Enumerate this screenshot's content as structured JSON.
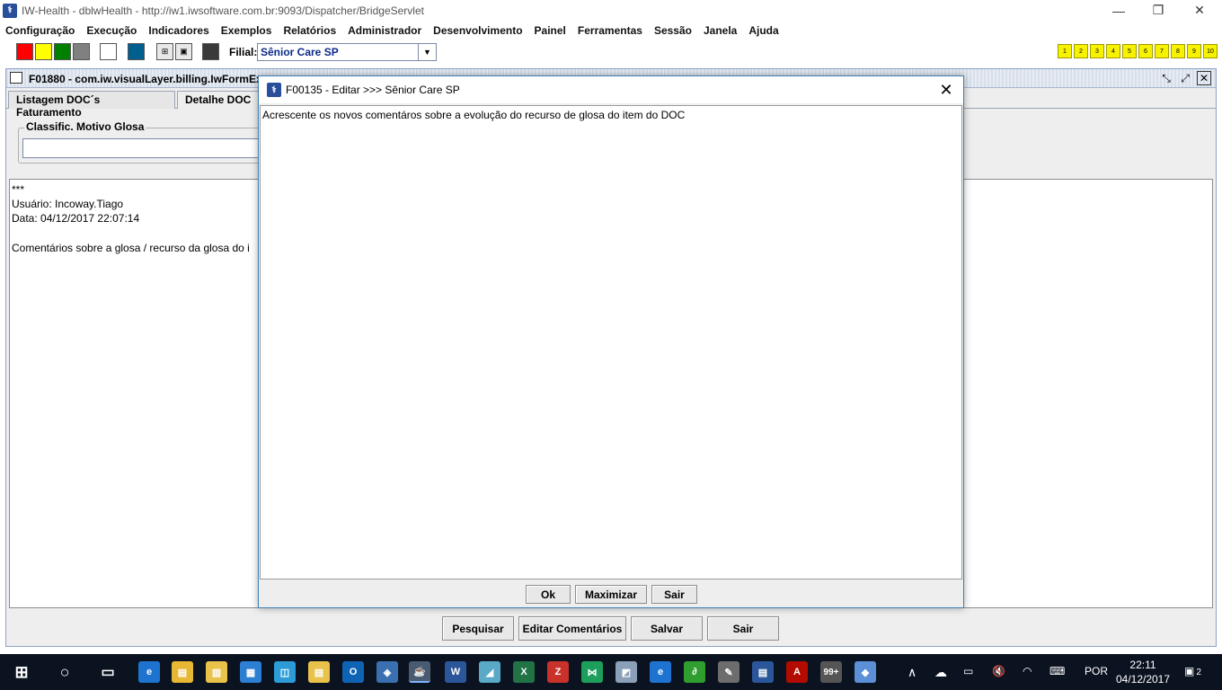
{
  "window": {
    "title": "IW-Health - dblwHealth - http://iw1.iwsoftware.com.br:9093/Dispatcher/BridgeServlet",
    "minimize": "—",
    "restore": "❐",
    "close": "✕"
  },
  "menu": [
    "Configuração",
    "Execução",
    "Indicadores",
    "Exemplos",
    "Relatórios",
    "Administrador",
    "Desenvolvimento",
    "Painel",
    "Ferramentas",
    "Sessão",
    "Janela",
    "Ajuda"
  ],
  "toolbar": {
    "swatches": [
      "#ff0000",
      "#ffff00",
      "#008000",
      "#808080",
      "#ffffff",
      "#005f8f",
      "#3a3a3a"
    ],
    "filial_label": "Filial:",
    "filial_value": "Sênior Care SP",
    "number_buttons": [
      "1",
      "2",
      "3",
      "4",
      "5",
      "6",
      "7",
      "8",
      "9",
      "10"
    ]
  },
  "internal_frame": {
    "title": "F01880 - com.iw.visualLayer.billing.IwFormEx",
    "tabs": [
      "Listagem DOC´s Faturamento",
      "Detalhe DOC"
    ],
    "group_label": "Classific. Motivo Glosa",
    "text_lines": [
      "***",
      "Usuário: Incoway.Tiago",
      "Data: 04/12/2017 22:07:14",
      "",
      "Comentários sobre a glosa / recurso da glosa do i"
    ],
    "buttons": {
      "search": "Pesquisar",
      "edit_comments": "Editar Comentários",
      "save": "Salvar",
      "exit": "Sair"
    }
  },
  "dialog": {
    "title": "F00135 - Editar >>> Sênior Care SP",
    "text": "Acrescente os novos comentáros sobre a evolução do recurso de glosa do item do DOC",
    "buttons": {
      "ok": "Ok",
      "maximize": "Maximizar",
      "exit": "Sair"
    }
  },
  "taskbar": {
    "language": "POR",
    "time": "22:11",
    "date": "04/12/2017",
    "notification_count": "2",
    "badge": "99+"
  },
  "colors": {
    "accent": "#3c7fb1",
    "taskbar": "#0b1220",
    "filial_text": "#0b2a8a",
    "number_button": "#f7f200"
  }
}
